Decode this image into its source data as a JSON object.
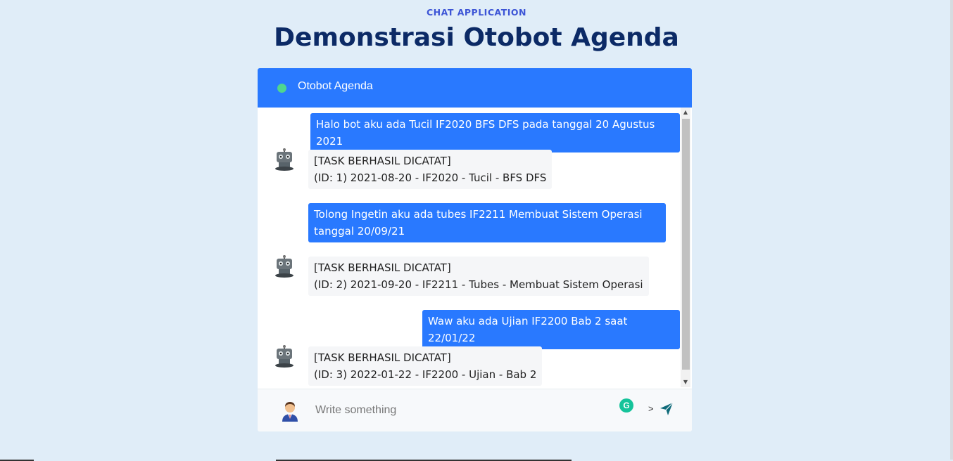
{
  "page": {
    "overline": "CHAT APPLICATION",
    "title": "Demonstrasi Otobot Agenda"
  },
  "chat": {
    "name": "Otobot Agenda",
    "status_color": "#4fd68f",
    "accent": "#2979ff",
    "messages": [
      {
        "from": "user",
        "lines": [
          "Halo bot aku ada Tucil IF2020 BFS DFS pada tanggal 20 Agustus 2021"
        ]
      },
      {
        "from": "bot",
        "lines": [
          "[TASK BERHASIL DICATAT]",
          "(ID: 1) 2021-08-20 - IF2020 - Tucil - BFS DFS"
        ]
      },
      {
        "from": "user",
        "lines": [
          "Tolong Ingetin aku ada tubes IF2211 Membuat Sistem Operasi",
          "tanggal 20/09/21"
        ]
      },
      {
        "from": "bot",
        "lines": [
          "[TASK BERHASIL DICATAT]",
          "(ID: 2) 2021-09-20 - IF2211 - Tubes - Membuat Sistem Operasi"
        ]
      },
      {
        "from": "user",
        "lines": [
          "Waw aku ada Ujian IF2200 Bab 2 saat 22/01/22"
        ]
      },
      {
        "from": "bot",
        "lines": [
          "[TASK BERHASIL DICATAT]",
          "(ID: 3) 2022-01-22 - IF2200 - Ujian - Bab 2"
        ]
      }
    ]
  },
  "input": {
    "placeholder": "Write something",
    "grammarly_label": "G",
    "gt_symbol": ">",
    "send_icon": "send-icon"
  }
}
